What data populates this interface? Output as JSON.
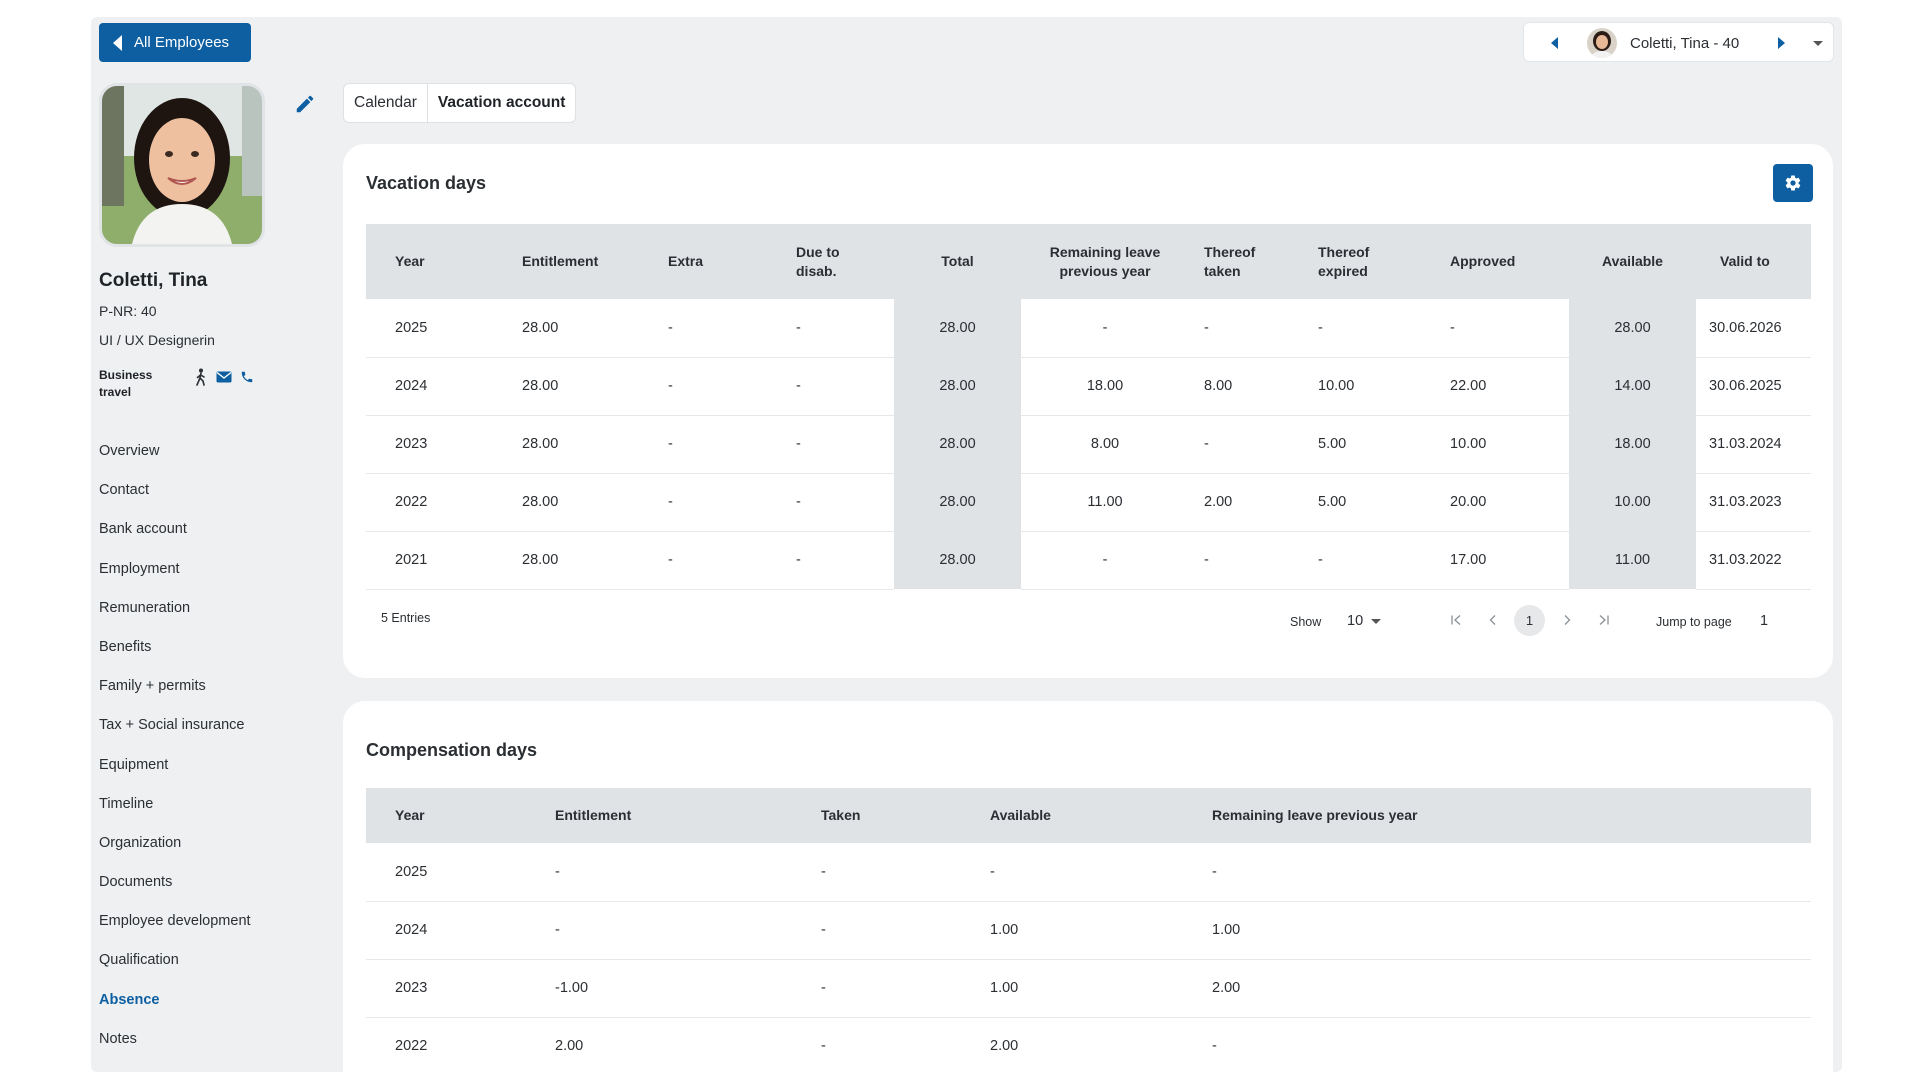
{
  "back_button": {
    "label": "All Employees"
  },
  "switcher": {
    "label": "Coletti, Tina - 40"
  },
  "employee": {
    "name": "Coletti, Tina",
    "pnr": "P-NR: 40",
    "role": "UI / UX Designerin",
    "status": "Business travel"
  },
  "nav": {
    "items": [
      {
        "label": "Overview"
      },
      {
        "label": "Contact"
      },
      {
        "label": "Bank account"
      },
      {
        "label": "Employment"
      },
      {
        "label": "Remuneration"
      },
      {
        "label": "Benefits"
      },
      {
        "label": "Family + permits"
      },
      {
        "label": "Tax + Social insurance"
      },
      {
        "label": "Equipment"
      },
      {
        "label": "Timeline"
      },
      {
        "label": "Organization"
      },
      {
        "label": "Documents"
      },
      {
        "label": "Employee development"
      },
      {
        "label": "Qualification"
      },
      {
        "label": "Absence"
      },
      {
        "label": "Notes"
      }
    ],
    "active": "Absence"
  },
  "tabs": [
    {
      "label": "Calendar"
    },
    {
      "label": "Vacation account"
    }
  ],
  "vacation": {
    "title": "Vacation days",
    "headers": [
      "Year",
      "Entitlement",
      "Extra",
      "Due to disab.",
      "Total",
      "Remaining leave previous year",
      "Thereof taken",
      "Thereof expired",
      "Approved",
      "Available",
      "Valid to"
    ],
    "rows": [
      [
        "2025",
        "28.00",
        "-",
        "-",
        "28.00",
        "-",
        "-",
        "-",
        "-",
        "28.00",
        "30.06.2026"
      ],
      [
        "2024",
        "28.00",
        "-",
        "-",
        "28.00",
        "18.00",
        "8.00",
        "10.00",
        "22.00",
        "14.00",
        "30.06.2025"
      ],
      [
        "2023",
        "28.00",
        "-",
        "-",
        "28.00",
        "8.00",
        "-",
        "5.00",
        "10.00",
        "18.00",
        "31.03.2024"
      ],
      [
        "2022",
        "28.00",
        "-",
        "-",
        "28.00",
        "11.00",
        "2.00",
        "5.00",
        "20.00",
        "10.00",
        "31.03.2023"
      ],
      [
        "2021",
        "28.00",
        "-",
        "-",
        "28.00",
        "-",
        "-",
        "-",
        "17.00",
        "11.00",
        "31.03.2022"
      ]
    ],
    "entries": "5 Entries",
    "show_label": "Show",
    "show_value": "10",
    "current_page": "1",
    "jump_label": "Jump to page",
    "jump_value": "1"
  },
  "compensation": {
    "title": "Compensation days",
    "headers": [
      "Year",
      "Entitlement",
      "Taken",
      "Available",
      "Remaining leave previous year"
    ],
    "rows": [
      [
        "2025",
        "-",
        "-",
        "-",
        "-"
      ],
      [
        "2024",
        "-",
        "-",
        "1.00",
        "1.00"
      ],
      [
        "2023",
        "-1.00",
        "-",
        "1.00",
        "2.00"
      ],
      [
        "2022",
        "2.00",
        "-",
        "2.00",
        "-"
      ]
    ]
  },
  "colors": {
    "accent": "#0d5fa1",
    "background": "#eef0f2",
    "header_fill": "#dfe3e6"
  },
  "icons": [
    "back-arrow-icon",
    "chevron-left-icon",
    "chevron-right-icon",
    "dropdown-caret-icon",
    "pencil-icon",
    "walking-person-icon",
    "mail-icon",
    "phone-icon",
    "gear-icon",
    "first-page-icon",
    "previous-page-icon",
    "next-page-icon",
    "last-page-icon"
  ]
}
